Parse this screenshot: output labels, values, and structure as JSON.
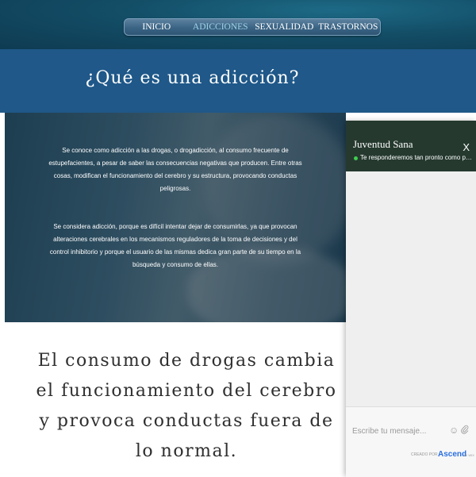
{
  "nav": {
    "items": [
      {
        "label": "INICIO",
        "active": false
      },
      {
        "label": "ADICCIONES",
        "active": true
      },
      {
        "label": "SEXUALIDAD",
        "active": false
      },
      {
        "label": "TRASTORNOS",
        "active": false
      }
    ]
  },
  "page": {
    "title": "¿Qué es una adicción?",
    "paragraph_1": "Se conoce como adicción a las drogas, o drogadicción, al consumo frecuente de estupefacientes, a pesar de saber las consecuencias negativas que producen. Entre otras cosas, modifican el funcionamiento del cerebro y su estructura, provocando conductas peligrosas.",
    "paragraph_2": "Se considera adicción, porque es difícil intentar dejar de consumirlas, ya que provocan alteraciones cerebrales en los mecanismos reguladores de la toma de decisiones y del control inhibitorio y porque el usuario de las mismas dedica gran parte de su tiempo en la búsqueda y consumo de ellas.",
    "statement": "El consumo de drogas cambia el funcionamiento del cerebro y provoca conductas fuera de lo normal."
  },
  "chat": {
    "name": "Juventud Sana",
    "status": "Te responderemos tan pronto como poda...",
    "close_label": "X",
    "input_placeholder": "Escribe tu mensaje...",
    "emoji_icon": "smiley-icon",
    "attach_icon": "paperclip-icon",
    "powered_label": "CREADO POR",
    "brand": "Ascend",
    "brand_sub": "BY WIX",
    "online_color": "#3fcf4e"
  },
  "colors": {
    "header_bg": "#134d66",
    "title_bar": "#1f5889",
    "chat_header": "#25392f",
    "accent": "#9fd2e6"
  }
}
